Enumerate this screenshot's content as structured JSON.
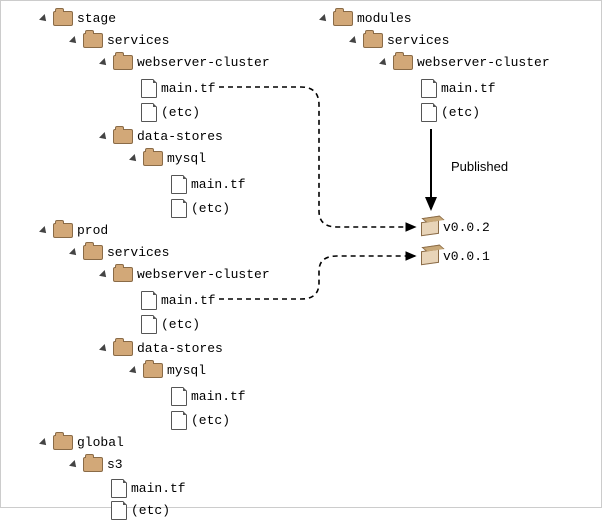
{
  "left_tree": {
    "stage": {
      "name": "stage",
      "services": {
        "name": "services",
        "webserver_cluster": {
          "name": "webserver-cluster",
          "main": "main.tf",
          "etc": "(etc)"
        }
      },
      "data_stores": {
        "name": "data-stores",
        "mysql": {
          "name": "mysql",
          "main": "main.tf",
          "etc": "(etc)"
        }
      }
    },
    "prod": {
      "name": "prod",
      "services": {
        "name": "services",
        "webserver_cluster": {
          "name": "webserver-cluster",
          "main": "main.tf",
          "etc": "(etc)"
        }
      },
      "data_stores": {
        "name": "data-stores",
        "mysql": {
          "name": "mysql",
          "main": "main.tf",
          "etc": "(etc)"
        }
      }
    },
    "global": {
      "name": "global",
      "s3": {
        "name": "s3",
        "main": "main.tf",
        "etc": "(etc)"
      }
    }
  },
  "right_tree": {
    "modules": {
      "name": "modules",
      "services": {
        "name": "services",
        "webserver_cluster": {
          "name": "webserver-cluster",
          "main": "main.tf",
          "etc": "(etc)"
        }
      }
    }
  },
  "published_label": "Published",
  "versions": {
    "v002": "v0.0.2",
    "v001": "v0.0.1"
  }
}
